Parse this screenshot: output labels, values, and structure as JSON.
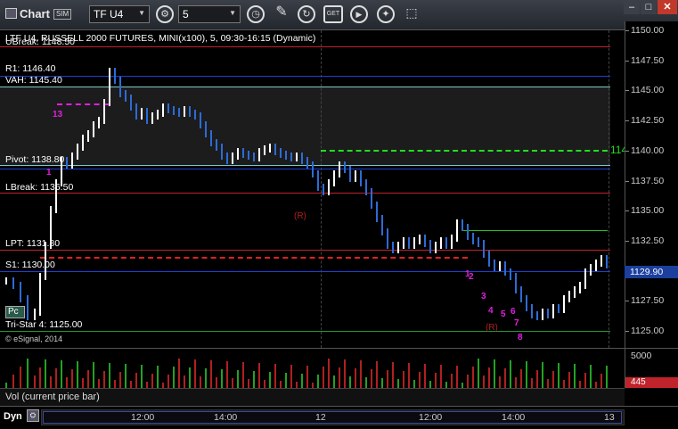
{
  "window": {
    "title": "Chart",
    "sim_badge": "SIM"
  },
  "toolbar": {
    "symbol": "TF U4",
    "interval": "5",
    "buttons": [
      "symbol-settings",
      "interval-clock",
      "draw-pen",
      "refresh",
      "get-data",
      "play",
      "tools"
    ],
    "button_glyphs": {
      "gear": "⚙",
      "clock": "◷",
      "pen": "✎",
      "refresh": "↻",
      "get": "GET",
      "play": "▶",
      "tools": "✦"
    },
    "window_controls": {
      "minimize": "–",
      "maximize": "□",
      "close": "✕"
    }
  },
  "chart": {
    "header": "LTF U4, RUSSELL 2000 FUTURES, MINI(x100), 5, 09:30-16:15 (Dynamic)",
    "copyright": "© eSignal, 2014",
    "pc_badge": "Pc",
    "levels": [
      {
        "label": "UBreak: 1148.50",
        "color": "#c0232b"
      },
      {
        "label": "R1: 1146.40",
        "color": "#1e3fd0"
      },
      {
        "label": "VAH: 1145.40",
        "color": "#7ec8c8"
      },
      {
        "label": "Pivot: 1138.80",
        "color": "#1e3fd0"
      },
      {
        "label": "LBreak: 1136.50",
        "color": "#c0232b"
      },
      {
        "label": "LPT: 1131.80",
        "color": "#c0232b"
      },
      {
        "label": "S1: 1130.00",
        "color": "#1e3fd0"
      },
      {
        "label": "Tri-Star 4: 1125.00",
        "color": "#1e9a3a"
      }
    ],
    "annotations": {
      "green_line_value": "114",
      "count_13": "13",
      "count_1": "1",
      "r_marker": "(R)",
      "r_marker_2": "(R)",
      "magenta_counts": [
        "1",
        "2",
        "3",
        "4",
        "5",
        "6",
        "7",
        "8"
      ]
    }
  },
  "price_axis": {
    "ticks": [
      "1150.00",
      "1147.50",
      "1145.00",
      "1142.50",
      "1140.00",
      "1137.50",
      "1135.00",
      "1132.50",
      "1130.00",
      "1127.50",
      "1125.00"
    ],
    "last_price": "1129.90"
  },
  "volume": {
    "label": "Vol (current price bar)",
    "axis_tick": "5000",
    "last_value": "445"
  },
  "time_axis": {
    "dyn_label": "Dyn",
    "dyn_icon": "⛭",
    "ticks": [
      "12:00",
      "14:00",
      "12",
      "12:00",
      "14:00",
      "13"
    ]
  },
  "colors": {
    "up_candle": "#ffffff",
    "down_candle": "#2d6bd6",
    "volume_up": "#24a124",
    "volume_down": "#b02020",
    "accent": "#1c3f9e"
  }
}
